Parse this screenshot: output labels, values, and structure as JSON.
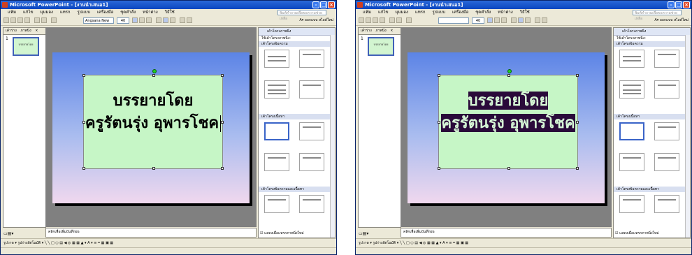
{
  "window": {
    "title": "Microsoft PowerPoint - [งานนำเสนอ1]",
    "menu": [
      "แฟ้ม",
      "แก้ไข",
      "มุมมอง",
      "แทรก",
      "รูปแบบ",
      "เครื่องมือ",
      "ชุดคำสั่ง",
      "หน้าต่าง",
      "วิธีใช้"
    ],
    "ask_placeholder": "พิมพ์คำถามเพื่อขอความช่วยเหลือ",
    "font_name": "Angsana New",
    "font_size": "40",
    "design_label": "ออกแบบ",
    "new_slide_label": "สไลด์ใหม่"
  },
  "outline": {
    "tabs": [
      "เค้าร่าง",
      "ภาพนิ่ง"
    ],
    "slide_number": "1"
  },
  "slide": {
    "line1": "บรรยายโดย",
    "line2": "ครูรัตนรุ่ง  อุพารโชค"
  },
  "notes_placeholder": "คลิกเพื่อเพิ่มบันทึกย่อ",
  "task_pane": {
    "title": "เค้าโครงภาพนิ่ง",
    "apply_label": "ใช้เค้าโครงภาพนิ่ง:",
    "sections": [
      "เค้าโครงข้อความ",
      "เค้าโครงเนื้อหา",
      "เค้าโครงข้อความและเนื้อหา"
    ],
    "footer": "แสดงเมื่อแทรกภาพนิ่งใหม่"
  },
  "drawbar": {
    "draw_label": "รูปวาด",
    "autoshapes_label": "รูปร่างอัตโนมัติ"
  }
}
